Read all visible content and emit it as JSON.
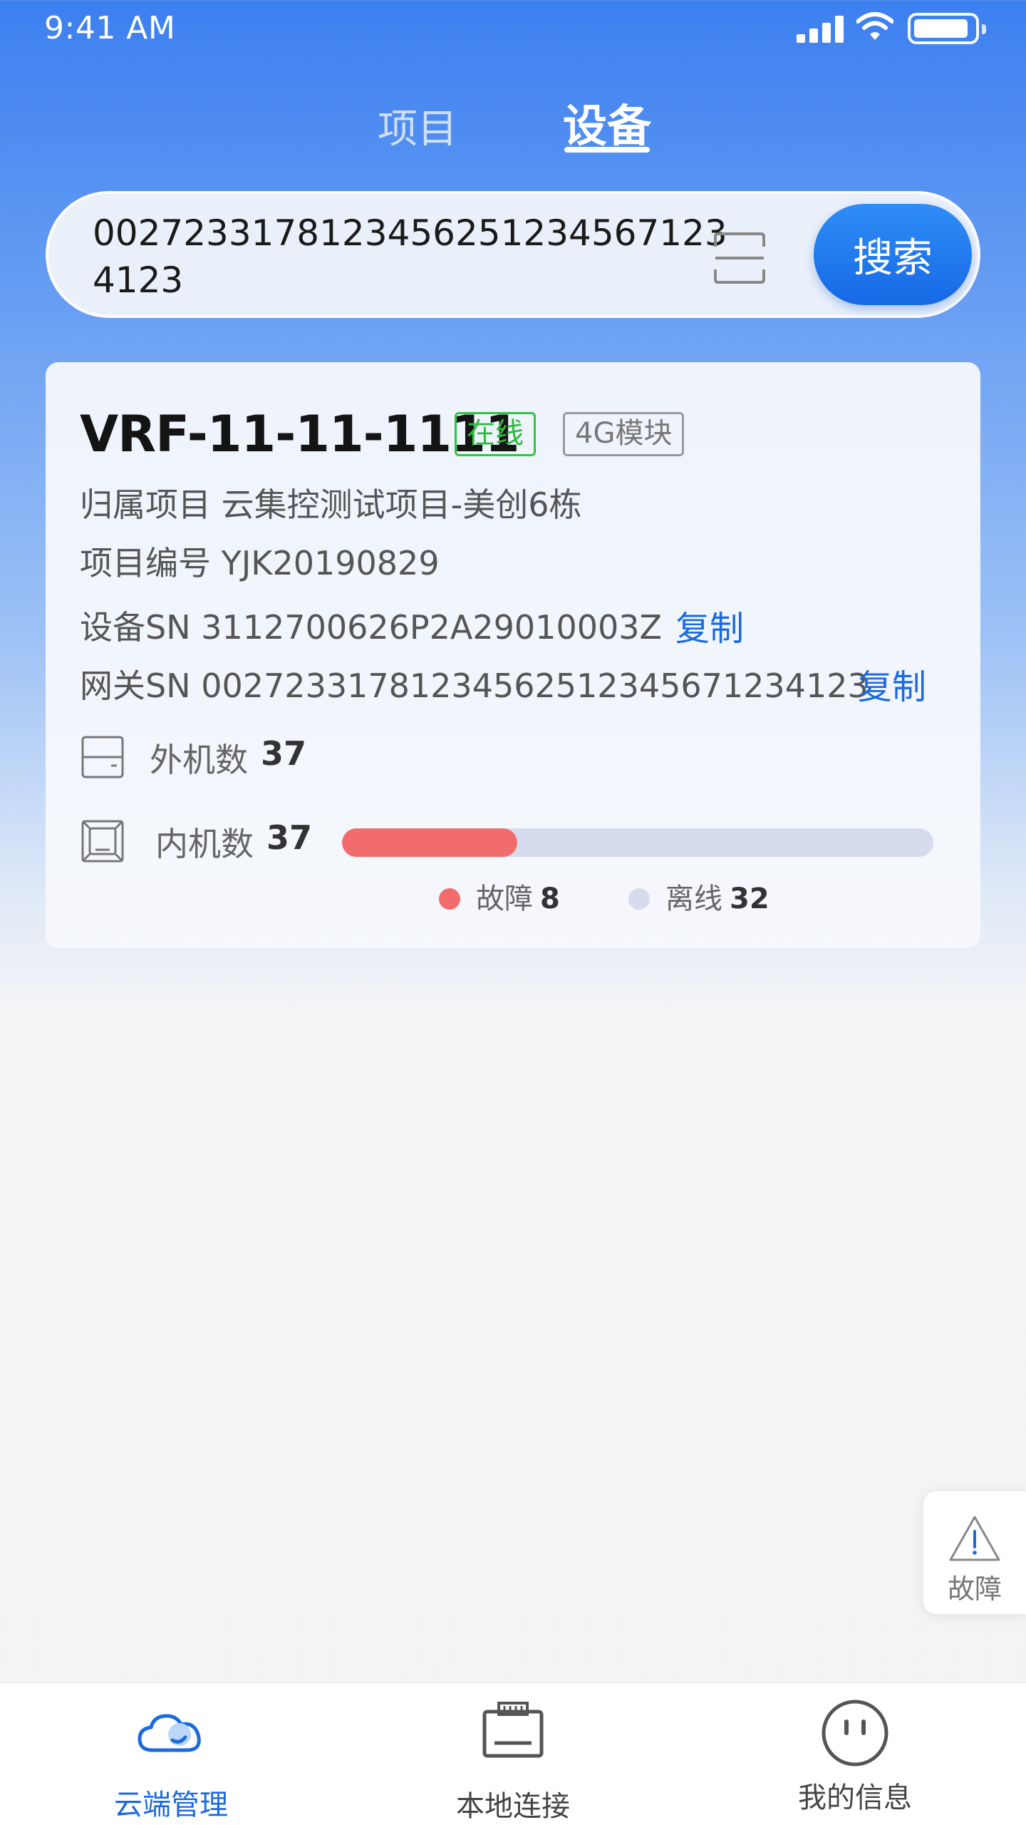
{
  "status_bar": {
    "time": "9:41 AM"
  },
  "tabs": [
    {
      "label": "项目",
      "active": false
    },
    {
      "label": "设备",
      "active": true
    }
  ],
  "search": {
    "value": "0027233178123456251234567 1234123",
    "display_value": "00272331781234562512345671234123",
    "button_label": "搜索",
    "scan_icon": "scan-icon"
  },
  "device": {
    "name": "VRF-11-11-1111",
    "status_tag": "在线",
    "module_tag": "4G模块",
    "project_label": "归属项目",
    "project_value": "云集控测试项目-美创6栋",
    "project_no_label": "项目编号",
    "project_no_value": "YJK20190829",
    "sn_label": "设备SN",
    "sn_value": "3112700626P2A29010003Z",
    "gateway_label": "网关SN",
    "gateway_value": "00272331781234562512345671234123",
    "copy_label": "复制",
    "outdoor_label": "外机数",
    "outdoor_count": "37",
    "indoor_label": "内机数",
    "indoor_count": "37",
    "indoor_fault_fraction": 0.296,
    "legend": [
      {
        "label": "故障",
        "value": "8",
        "color": "#f26b6d"
      },
      {
        "label": "离线",
        "value": "32",
        "color": "#d6dced"
      }
    ]
  },
  "fault_button": {
    "label": "故障",
    "icon": "warning-triangle-icon"
  },
  "bottom_nav": [
    {
      "label": "云端管理",
      "icon": "cloud-icon",
      "active": true
    },
    {
      "label": "本地连接",
      "icon": "router-icon",
      "active": false
    },
    {
      "label": "我的信息",
      "icon": "face-icon",
      "active": false
    }
  ],
  "colors": {
    "accent": "#1a6ae0",
    "online": "#2dbb3f",
    "fault": "#f26b6d",
    "offline": "#d6dced"
  }
}
